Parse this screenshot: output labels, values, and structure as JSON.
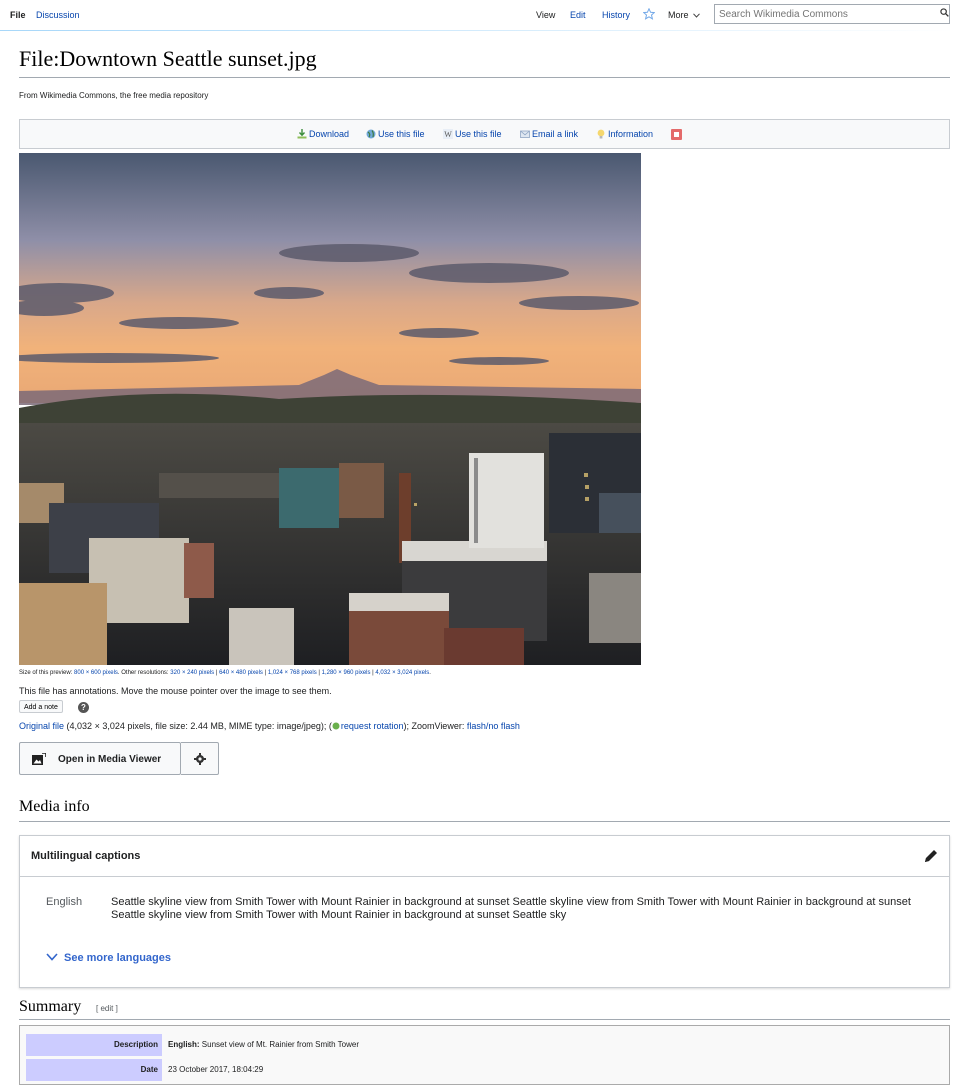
{
  "tabs": {
    "left": [
      {
        "label": "File",
        "active": true
      },
      {
        "label": "Discussion",
        "active": false
      }
    ],
    "right": [
      "View",
      "Edit",
      "History",
      "More"
    ]
  },
  "search": {
    "placeholder": "Search Wikimedia Commons"
  },
  "page": {
    "title": "File:Downtown Seattle sunset.jpg",
    "tagline": "From Wikimedia Commons, the free media repository"
  },
  "toolbar": {
    "items": [
      {
        "label": "Download",
        "icon": "download-icon"
      },
      {
        "label": "Use this file",
        "icon": "globe-icon"
      },
      {
        "label": "Use this file",
        "icon": "w-icon"
      },
      {
        "label": "Email a link",
        "icon": "email-icon"
      },
      {
        "label": "Information",
        "icon": "info-bulb-icon"
      }
    ]
  },
  "preview": {
    "prefix": "Size of this preview:",
    "current": "800 × 600 pixels",
    "other_label": ". Other resolutions:",
    "resolutions": [
      "320 × 240 pixels",
      "640 × 480 pixels",
      "1,024 × 768 pixels",
      "1,280 × 960 pixels",
      "4,032 × 3,024 pixels"
    ],
    "suffix": "."
  },
  "annotations": {
    "notice": "This file has annotations. Move the mouse pointer over the image to see them.",
    "add_note": "Add a note",
    "help": "?"
  },
  "original": {
    "link": "Original file",
    "details": "(4,032 × 3,024 pixels, file size: 2.44 MB, MIME type: image/jpeg); (",
    "rotation": "request rotation",
    "after_rotation": "); ZoomViewer:",
    "zoom": "flash/no flash"
  },
  "media_viewer": {
    "label": "Open in Media Viewer"
  },
  "media_info": {
    "heading": "Media info"
  },
  "captions": {
    "title": "Multilingual captions",
    "language": "English",
    "text": "Seattle skyline view from Smith Tower with Mount Rainier in background at sunset  Seattle skyline view from Smith Tower with Mount Rainier in background at sunset Seattle skyline view from Smith Tower with Mount Rainier in background at sunset Seattle sky",
    "see_more": "See more languages"
  },
  "summary": {
    "heading": "Summary",
    "edit": "[ edit ]",
    "rows": [
      {
        "label": "Description",
        "value_bold": "English:",
        "value": " Sunset view of Mt. Rainier from Smith Tower"
      },
      {
        "label": "Date",
        "value_bold": "",
        "value": "23 October 2017, 18:04:29"
      }
    ]
  },
  "colors": {
    "link": "#0645ad",
    "accent": "#36c",
    "label_bg": "#ccccff"
  }
}
